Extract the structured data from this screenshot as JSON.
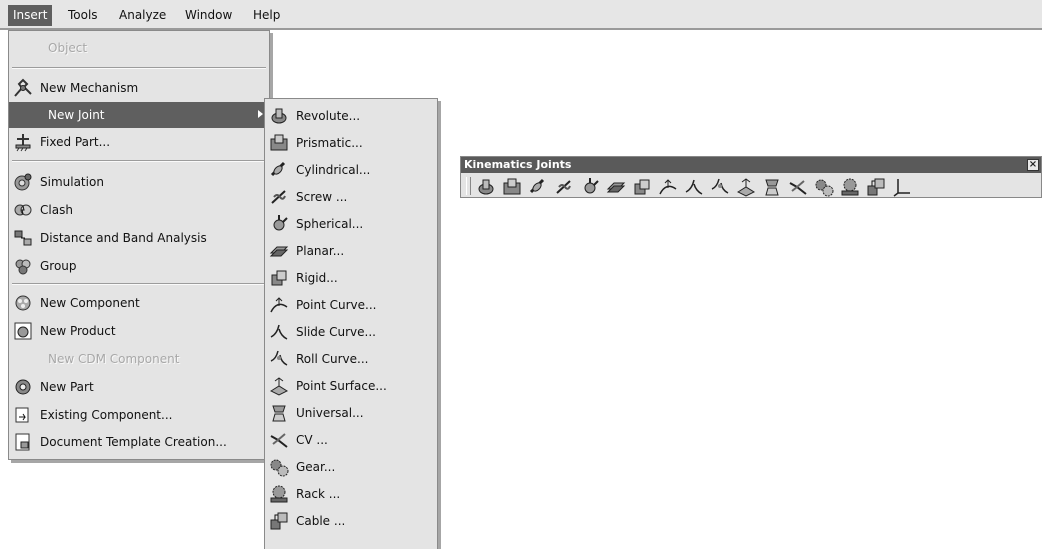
{
  "menubar": {
    "items": [
      {
        "label": "Insert",
        "active": true
      },
      {
        "label": "Tools"
      },
      {
        "label": "Analyze"
      },
      {
        "label": "Window"
      },
      {
        "label": "Help"
      }
    ]
  },
  "insert_menu": {
    "object": "Object",
    "new_mechanism": "New Mechanism",
    "new_joint": "New Joint",
    "fixed_part": "Fixed Part...",
    "simulation": "Simulation",
    "clash": "Clash",
    "distance_band": "Distance and Band Analysis",
    "group": "Group",
    "new_component": "New Component",
    "new_product": "New Product",
    "new_cdm_component": "New CDM Component",
    "new_part": "New Part",
    "existing_component": "Existing Component...",
    "document_template": "Document Template Creation..."
  },
  "joint_menu": {
    "revolute": "Revolute...",
    "prismatic": "Prismatic...",
    "cylindrical": "Cylindrical...",
    "screw": "Screw ...",
    "spherical": "Spherical...",
    "planar": "Planar...",
    "rigid": "Rigid...",
    "point_curve": "Point Curve...",
    "slide_curve": "Slide Curve...",
    "roll_curve": "Roll Curve...",
    "point_surface": "Point Surface...",
    "universal": "Universal...",
    "cv": "CV ...",
    "gear": "Gear...",
    "rack": "Rack ...",
    "cable": "Cable ..."
  },
  "toolbar": {
    "title": "Kinematics Joints",
    "close": "×"
  },
  "colors": {
    "menu_bg": "#e4e4e4",
    "highlight": "#5f5f5f",
    "disabled_text": "#a8a8a8",
    "titlebar": "#5a5a5a"
  }
}
